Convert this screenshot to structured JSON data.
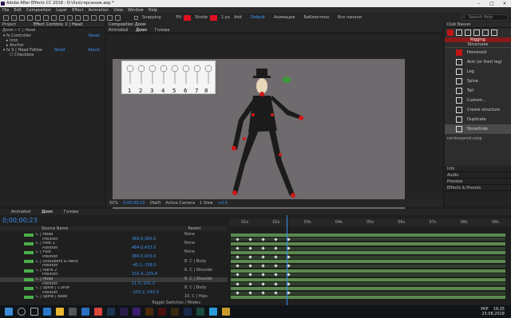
{
  "titlebar": {
    "title": "Adobe After Effects CC 2018 - D:\\Xxx\\герсанаж.aep *"
  },
  "menu": [
    "File",
    "Edit",
    "Composition",
    "Layer",
    "Effect",
    "Animation",
    "View",
    "Window",
    "Help"
  ],
  "toolbar": {
    "snapping": "Snapping",
    "fill": "Fill",
    "stroke": "Stroke",
    "stroke_px": "1 px",
    "add": "Add",
    "workspaces": [
      "Default",
      "Анимация",
      "Библиотеки",
      "Все панели"
    ],
    "active_workspace": "Default",
    "search_placeholder": "Search Help"
  },
  "project_panel": {
    "tabs": [
      "Project",
      "Effect Controls: C | Head"
    ],
    "crumb": "Доом • C | Head",
    "rows": [
      {
        "name": "Controller",
        "value": "Reset"
      },
      {
        "name": "Icon",
        "value": ""
      },
      {
        "name": "Anchor",
        "value": ""
      },
      {
        "name": "S | Head Follow",
        "value": "Reset",
        "extra": "About"
      },
      {
        "name": "Checkbox",
        "value": ""
      }
    ]
  },
  "comp_panel": {
    "tab": "Composition Доом",
    "subtabs": [
      "Animated",
      "Доом",
      "Голова"
    ],
    "zoom": "50%",
    "time": "0;00;00;23",
    "quality": "(Half)",
    "camera": "Active Camera",
    "views": "1 View",
    "offset": "+0.0"
  },
  "duik": {
    "title": "Duik Bassel",
    "section": "Rigging",
    "structures_label": "Structures",
    "items": [
      "Hominoid",
      "Arm (or front leg)",
      "Leg",
      "Spine",
      "Tail",
      "Custom...",
      "Create structure",
      "Duplicate",
      "Show/hide"
    ],
    "link_text": "rainboxprod.coop"
  },
  "side_panels": [
    "Info",
    "Audio",
    "Preview",
    "Effects & Presets"
  ],
  "timeline": {
    "tabs": [
      "Animated",
      "Доом",
      "Голова"
    ],
    "timecode": "0;00;00;23",
    "col_layer": "Source Name",
    "col_parent": "Parent",
    "toggle_text": "Toggle Switches / Modes",
    "layers": [
      {
        "name": "C | Head",
        "color": "#4bb04b",
        "parent": "None"
      },
      {
        "name": "Position",
        "color": "",
        "value": "366.0,366.0",
        "parent": ""
      },
      {
        "name": "C | Foot 2",
        "color": "#4bb04b",
        "parent": "None"
      },
      {
        "name": "Position",
        "color": "",
        "value": "484.0,433.0",
        "parent": ""
      },
      {
        "name": "C | Foot",
        "color": "#4bb04b",
        "parent": "None"
      },
      {
        "name": "Position",
        "color": "",
        "value": "380.0,433.0",
        "parent": ""
      },
      {
        "name": "C | Shoulders & Neck",
        "color": "#4bb04b",
        "parent": "8. C | Body"
      },
      {
        "name": "Position",
        "color": "",
        "value": "-40.1,-158.0",
        "parent": ""
      },
      {
        "name": "C | Hand 2",
        "color": "#4bb04b",
        "parent": "6. C | Shoulde"
      },
      {
        "name": "Position",
        "color": "",
        "value": "232.4,-225.4",
        "parent": ""
      },
      {
        "name": "C | Head",
        "color": "#4bb04b",
        "parent": "6. C | Shoulde"
      },
      {
        "name": "Position",
        "color": "",
        "value": "11.5,-101.3",
        "parent": ""
      },
      {
        "name": "C | Spine | Curve",
        "color": "#4bb04b",
        "parent": "8. C | Body"
      },
      {
        "name": "Position",
        "color": "",
        "value": "-103.2,-243.3",
        "parent": ""
      },
      {
        "name": "C | Spine | Base",
        "color": "#4bb04b",
        "parent": "10. C | Hips"
      }
    ],
    "ruler_labels": [
      "01s",
      "02s",
      "03s",
      "04s",
      "05s",
      "06s",
      "07s",
      "08s",
      "09s"
    ]
  },
  "taskbar": {
    "time": "19:25",
    "date": "23.08.2018",
    "lang": "УКР"
  }
}
